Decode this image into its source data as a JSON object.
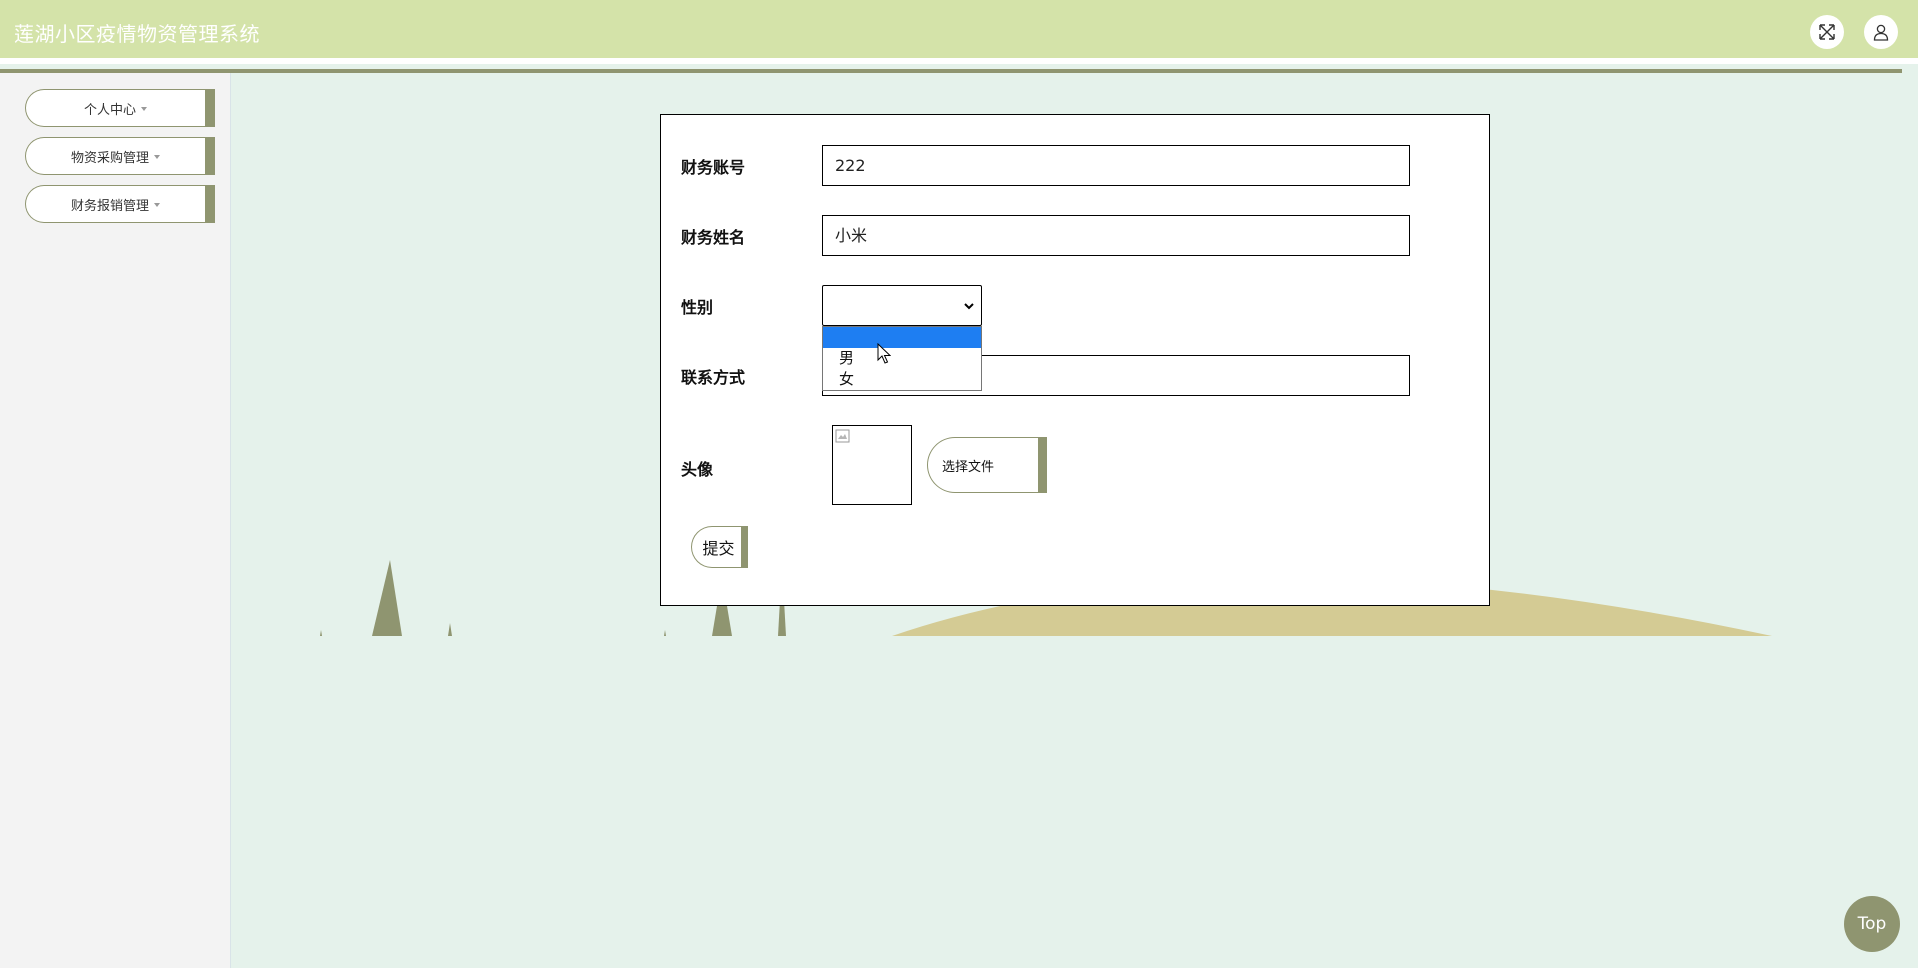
{
  "app": {
    "title": "莲湖小区疫情物资管理系统"
  },
  "header": {
    "fullscreen_icon": "fullscreen-icon",
    "user_icon": "user-icon"
  },
  "sidebar": {
    "items": [
      {
        "label": "个人中心"
      },
      {
        "label": "物资采购管理"
      },
      {
        "label": "财务报销管理"
      }
    ]
  },
  "form": {
    "account": {
      "label": "财务账号",
      "value": "222"
    },
    "name": {
      "label": "财务姓名",
      "value": "小米"
    },
    "gender": {
      "label": "性别",
      "value": "",
      "options": [
        "",
        "男",
        "女"
      ],
      "highlighted_index": 0
    },
    "contact": {
      "label": "联系方式",
      "value": ""
    },
    "avatar": {
      "label": "头像",
      "file_button": "选择文件"
    },
    "submit": "提交"
  },
  "back_to_top": "Top",
  "colors": {
    "header_bg": "#d4e3a9",
    "accent": "#8f9570",
    "content_bg": "#e5f2eb",
    "sidebar_bg": "#f3f3f3",
    "hill": "#d4cb94",
    "highlight": "#1e7ef2"
  }
}
